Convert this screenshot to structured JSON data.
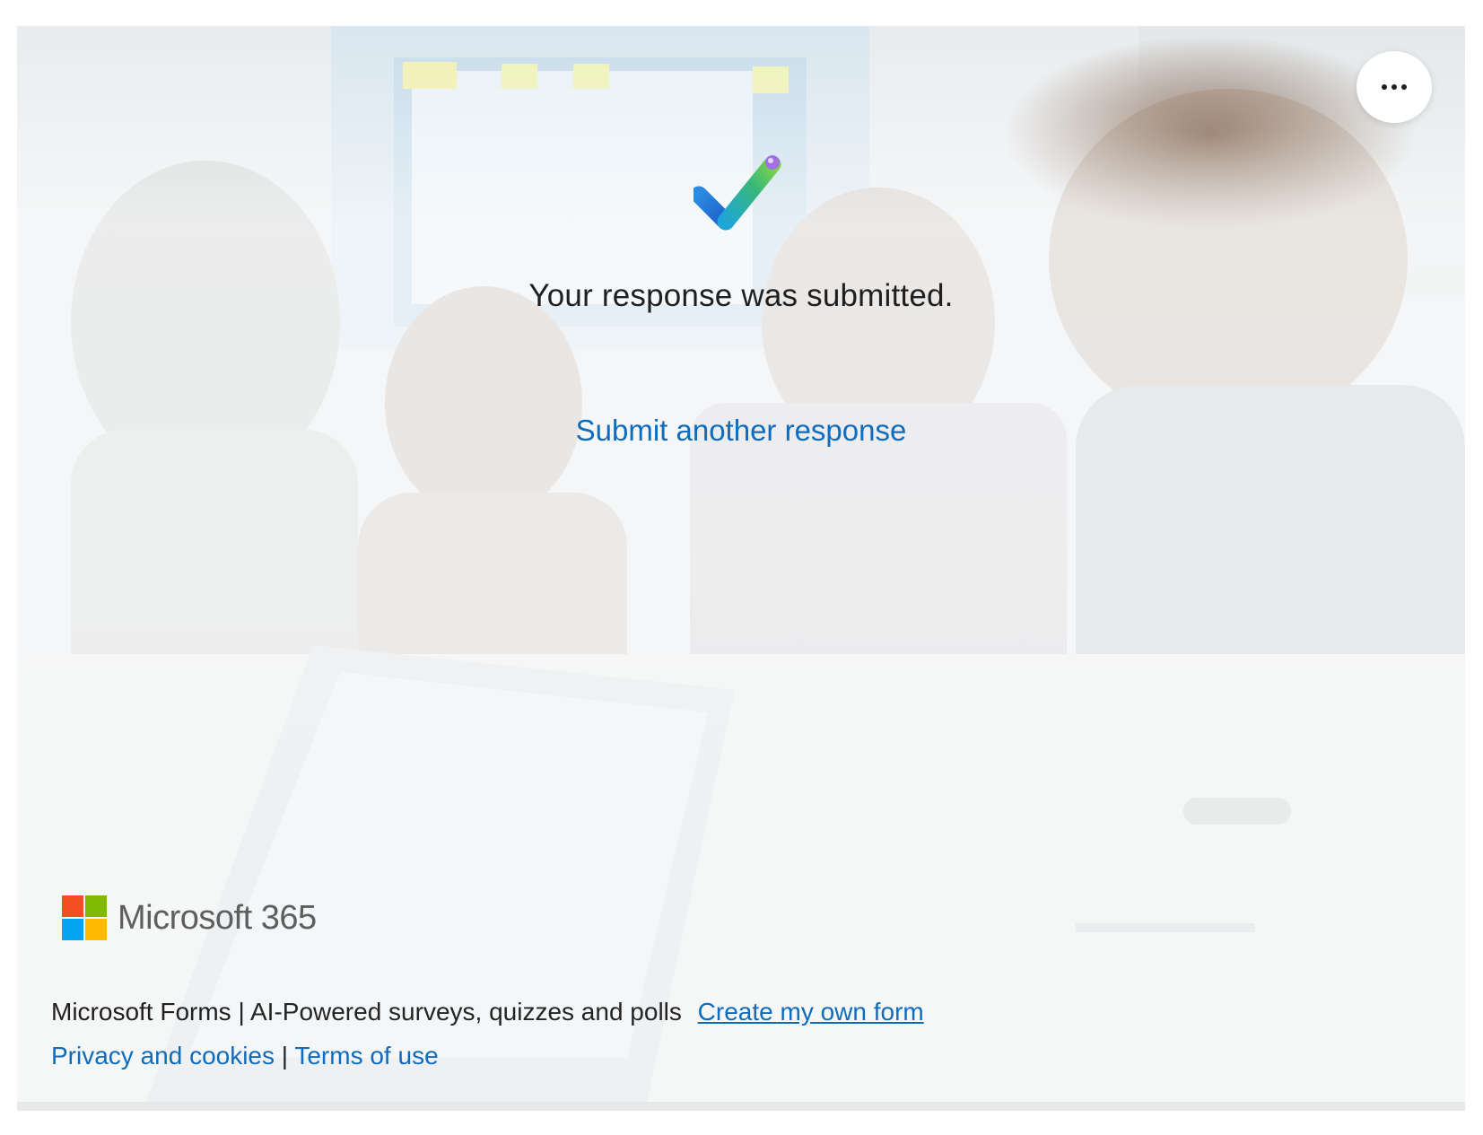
{
  "more_menu": {
    "icon": "more-horizontal-icon"
  },
  "confirmation": {
    "icon": "checkmark-icon",
    "title": "Your response was submitted.",
    "submit_another_label": "Submit another response"
  },
  "branding": {
    "logo_text": "Microsoft 365",
    "logo_colors": [
      "#f25022",
      "#7fba00",
      "#00a4ef",
      "#ffb900"
    ]
  },
  "footer": {
    "product_name": "Microsoft Forms",
    "separator": "|",
    "tagline": "AI-Powered surveys, quizzes and polls",
    "create_link": "Create my own form",
    "privacy_link": "Privacy and cookies",
    "terms_link": "Terms of use"
  },
  "colors": {
    "link": "#0f6cbd",
    "text": "#1f1f1f"
  }
}
